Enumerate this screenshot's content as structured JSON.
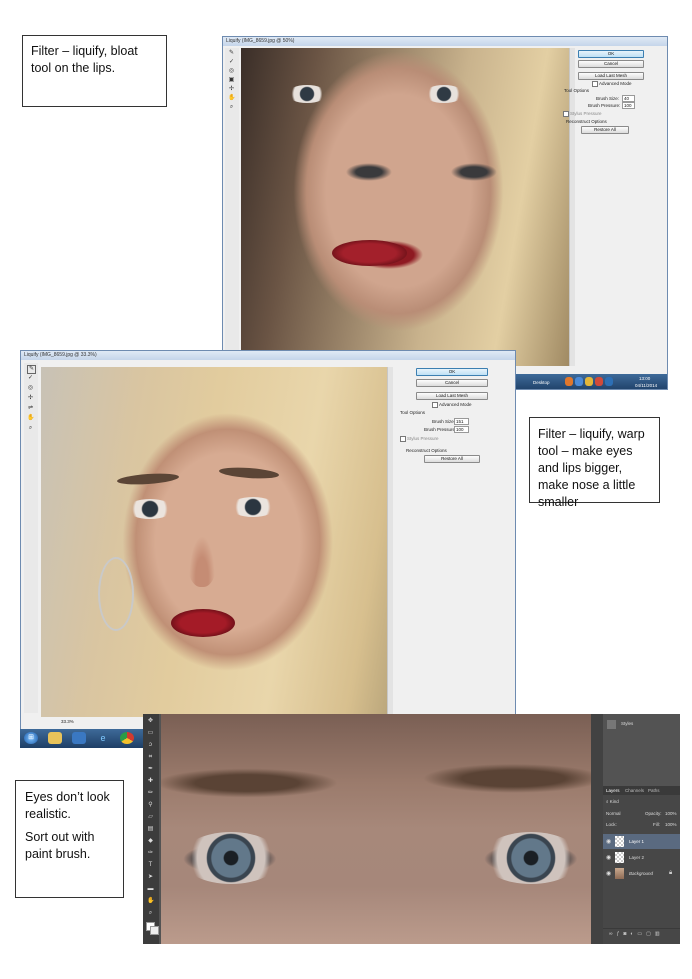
{
  "annotations": {
    "note1": "Filter – liquify, bloat tool on the lips.",
    "note2": "Filter – liquify, warp tool – make eyes and lips bigger, make nose a little smaller",
    "note3_line1": "Eyes don’t look realistic.",
    "note3_line2": "Sort out with paint brush."
  },
  "screenshot1": {
    "title": "Liquify (IMG_8659.jpg @ 50%)",
    "ok": "OK",
    "cancel": "Cancel",
    "load_last_mesh": "Load Last Mesh",
    "advanced_mode": "Advanced Mode",
    "tool_options": "Tool Options",
    "brush_size_label": "Brush Size:",
    "brush_size": "40",
    "brush_pressure_label": "Brush Pressure:",
    "brush_pressure": "100",
    "stylus_pressure": "Stylus Pressure",
    "reconstruct_options": "Reconstruct Options",
    "restore_all": "Restore All",
    "taskbar_desktop": "Desktop",
    "clock_time": "13:00",
    "clock_date": "04/11/2014"
  },
  "screenshot2": {
    "title": "Liquify (IMG_8659.jpg @ 33.3%)",
    "ok": "OK",
    "cancel": "Cancel",
    "load_last_mesh": "Load Last Mesh",
    "advanced_mode": "Advanced Mode",
    "tool_options": "Tool Options",
    "brush_size_label": "Brush Size:",
    "brush_size": "151",
    "brush_pressure_label": "Brush Pressure:",
    "brush_pressure": "100",
    "stylus_pressure": "Stylus Pressure",
    "reconstruct_options": "Reconstruct Options",
    "restore_all": "Restore All",
    "zoom": "33.3%"
  },
  "screenshot3": {
    "styles_label": "Styles",
    "tabs": [
      "Layers",
      "Channels",
      "Paths"
    ],
    "kind_label": "Kind",
    "blend_mode": "Normal",
    "opacity_label": "Opacity:",
    "opacity": "100%",
    "lock_label": "Lock:",
    "fill_label": "Fill:",
    "fill": "100%",
    "layers": [
      "Layer 1",
      "Layer 2",
      "Background"
    ]
  },
  "colors": {
    "window_border": "#6e8bb0",
    "ok_button": "#bfe0f5",
    "ps_panel_dark": "#3a3a3a",
    "lipstick": "#8e1a22",
    "taskbar": "#1e3f66"
  }
}
